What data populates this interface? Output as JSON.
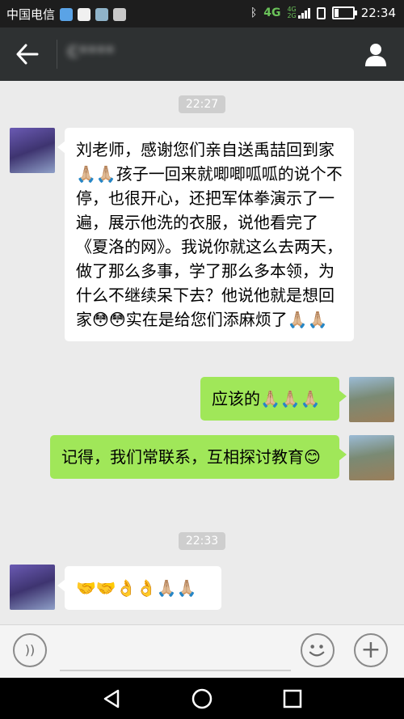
{
  "status_bar": {
    "carrier": "中国电信",
    "network": "4G",
    "network_small_top": "4G",
    "network_small_bottom": "2G",
    "time": "22:34"
  },
  "chat": {
    "contact_name": "C****",
    "messages": [
      {
        "type": "timestamp",
        "text": "22:27"
      },
      {
        "type": "received",
        "text": "刘老师，感谢您们亲自送禹喆回到家🙏🏼🙏🏼孩子一回来就唧唧呱呱的说个不停，也很开心，还把军体拳演示了一遍，展示他洗的衣服，说他看完了《夏洛的网》。我说你就这么去两天，做了那么多事，学了那么多本领，为什么不继续呆下去？他说他就是想回家😳😳实在是给您们添麻烦了🙏🏼🙏🏼"
      },
      {
        "type": "sent",
        "text": "应该的🙏🏼🙏🏼🙏🏼"
      },
      {
        "type": "sent",
        "text": "记得，我们常联系，互相探讨教育😊"
      },
      {
        "type": "timestamp",
        "text": "22:33"
      },
      {
        "type": "received",
        "text": "🤝🤝👌👌🙏🏼🙏🏼"
      }
    ]
  },
  "icons": {
    "back": "arrow-left-icon",
    "profile": "person-icon",
    "voice": "voice-icon",
    "emoji": "smiley-icon",
    "more": "plus-icon",
    "nav_back": "triangle-back-icon",
    "nav_home": "circle-home-icon",
    "nav_recent": "square-recent-icon"
  },
  "colors": {
    "title_bar": "#2e3132",
    "sent_bubble": "#a0e759",
    "received_bubble": "#ffffff",
    "chat_background": "#ebebeb"
  }
}
